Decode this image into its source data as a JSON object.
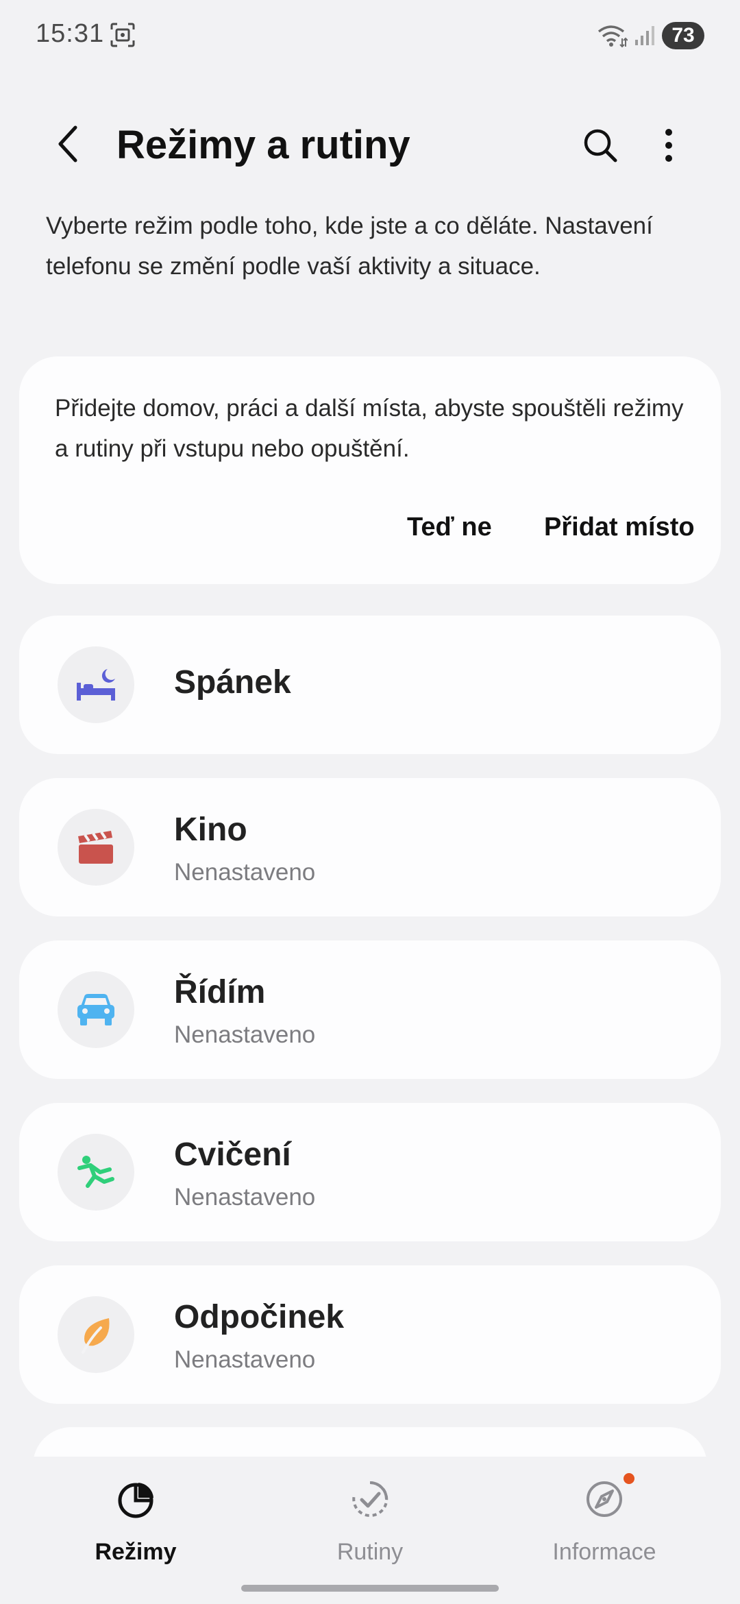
{
  "status_bar": {
    "time": "15:31",
    "battery": "73",
    "icons": [
      "screenshot-icon",
      "wifi-icon",
      "signal-icon"
    ]
  },
  "header": {
    "title": "Režimy a rutiny",
    "back_icon": "back-arrow-icon",
    "search_icon": "search-icon",
    "more_icon": "more-vertical-icon"
  },
  "intro_text": "Vyberte režim podle toho, kde jste a co děláte. Nastavení telefonu se změní podle vaší aktivity a situace.",
  "location_card": {
    "text": "Přidejte domov, práci a další místa, abyste spouštěli režimy a rutiny při vstupu nebo opuštění.",
    "not_now_label": "Teď ne",
    "add_place_label": "Přidat místo"
  },
  "modes": [
    {
      "name": "Spánek",
      "status": "",
      "icon": "bed-moon-icon",
      "color": "#5b5fd6"
    },
    {
      "name": "Kino",
      "status": "Nenastaveno",
      "icon": "clapperboard-icon",
      "color": "#c9534d"
    },
    {
      "name": "Řídím",
      "status": "Nenastaveno",
      "icon": "car-icon",
      "color": "#4fb3f0"
    },
    {
      "name": "Cvičení",
      "status": "Nenastaveno",
      "icon": "running-icon",
      "color": "#2fcf7a"
    },
    {
      "name": "Odpočinek",
      "status": "Nenastaveno",
      "icon": "leaf-icon",
      "color": "#f6a94d"
    }
  ],
  "bottom_nav": {
    "tabs": [
      {
        "label": "Režimy",
        "icon": "modes-icon",
        "active": true
      },
      {
        "label": "Rutiny",
        "icon": "routines-icon",
        "active": false
      },
      {
        "label": "Informace",
        "icon": "compass-icon",
        "active": false,
        "badge": true
      }
    ],
    "badge_color": "#e5541f"
  }
}
